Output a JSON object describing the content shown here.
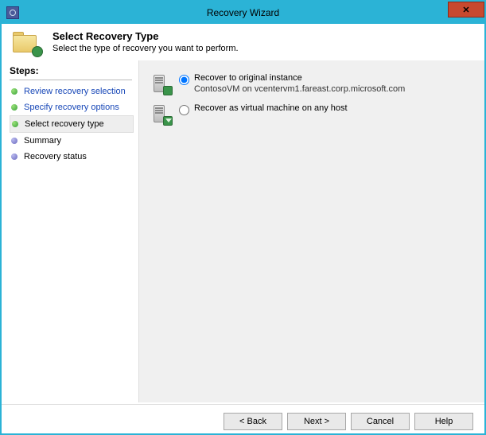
{
  "window": {
    "title": "Recovery Wizard"
  },
  "header": {
    "title": "Select Recovery Type",
    "subtitle": "Select the type of recovery you want to perform."
  },
  "steps": {
    "title": "Steps:",
    "items": [
      {
        "label": "Review recovery selection",
        "state": "done",
        "link": true
      },
      {
        "label": "Specify recovery options",
        "state": "done",
        "link": true
      },
      {
        "label": "Select recovery type",
        "state": "done",
        "current": true
      },
      {
        "label": "Summary",
        "state": "pending"
      },
      {
        "label": "Recovery status",
        "state": "pending"
      }
    ]
  },
  "options": {
    "original": {
      "label": "Recover to original instance",
      "detail": "ContosoVM on vcentervm1.fareast.corp.microsoft.com",
      "selected": true
    },
    "anyhost": {
      "label": "Recover as virtual machine on any host",
      "selected": false
    }
  },
  "buttons": {
    "back": "< Back",
    "next": "Next >",
    "cancel": "Cancel",
    "help": "Help"
  }
}
